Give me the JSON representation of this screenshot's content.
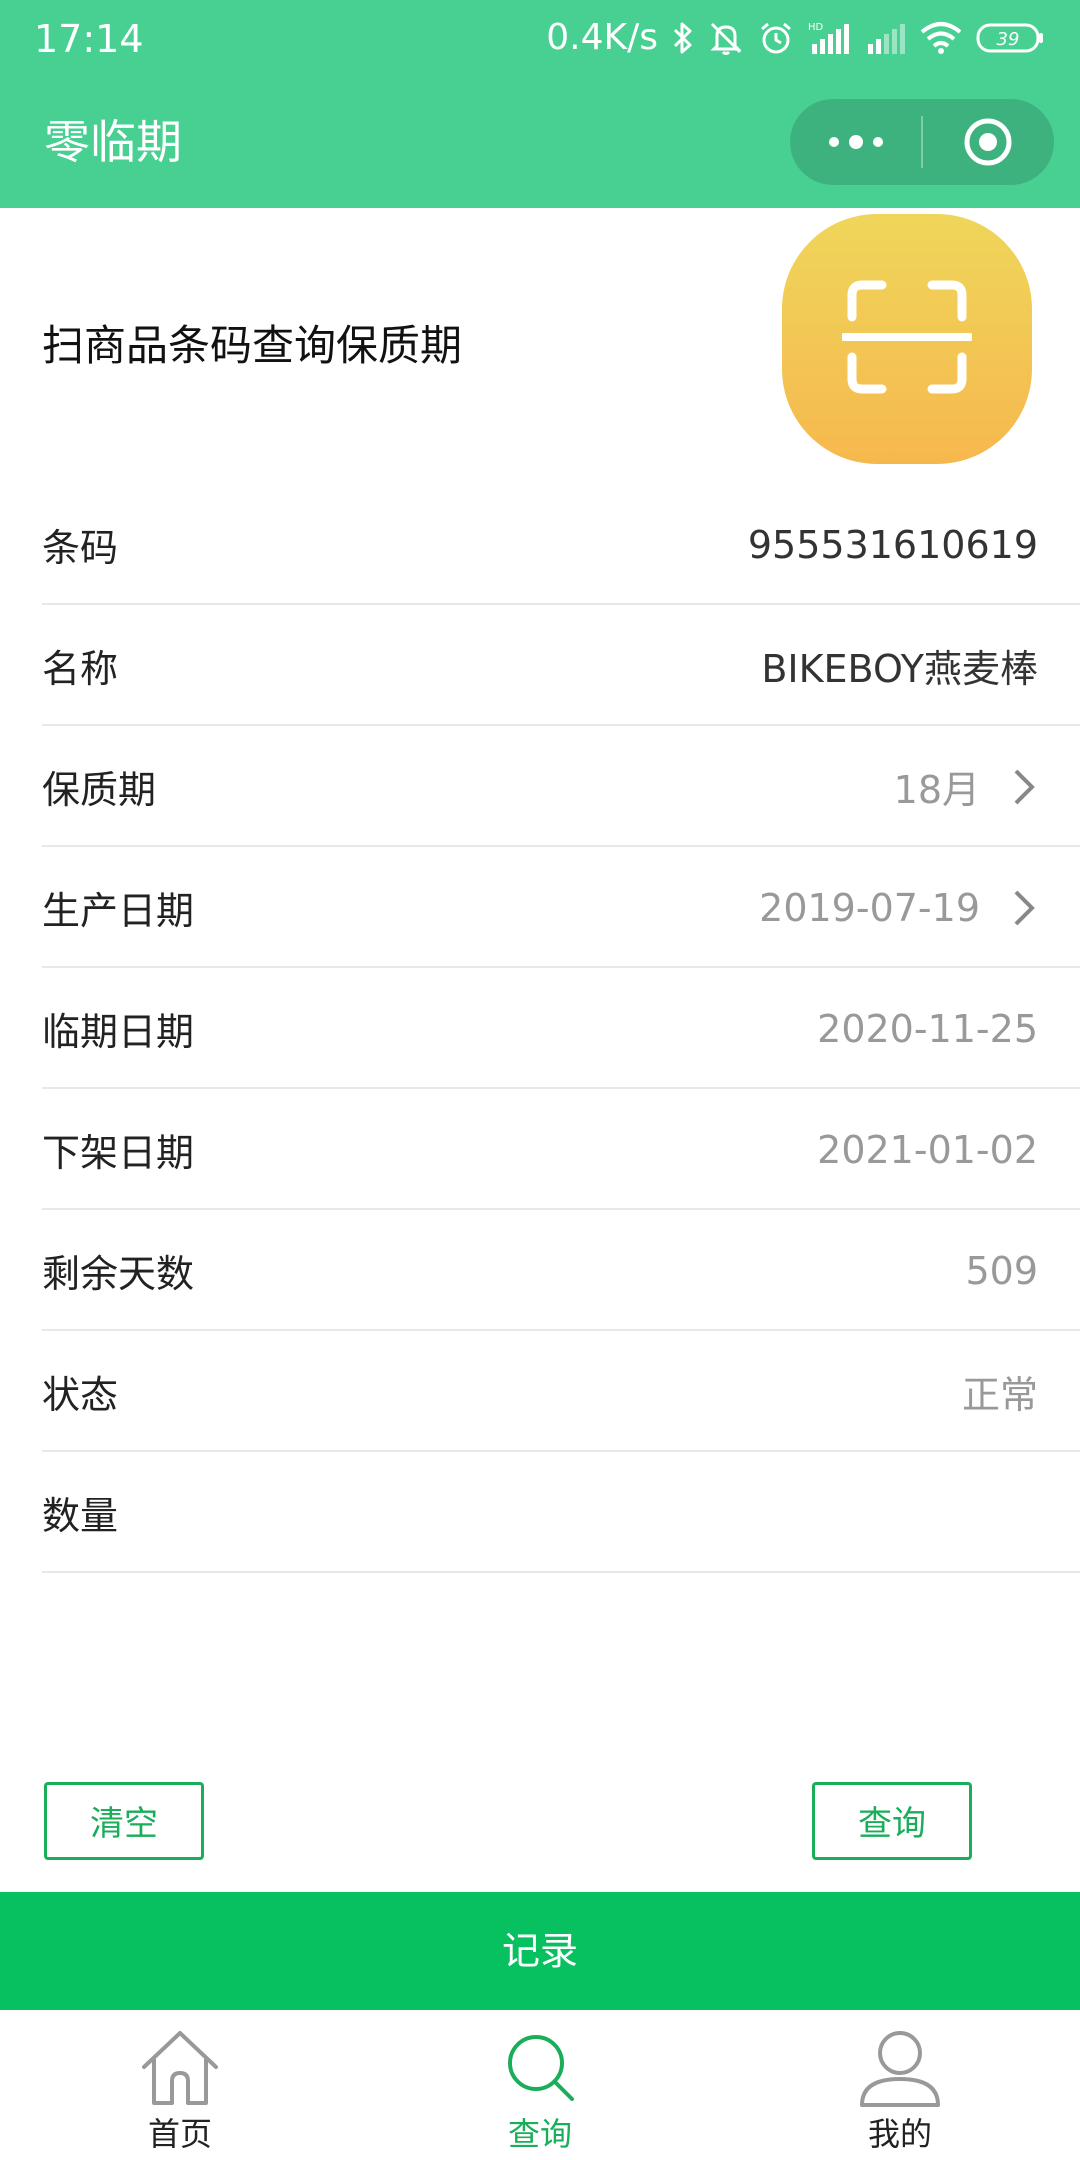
{
  "status_bar": {
    "time": "17:14",
    "network_speed": "0.4K/s",
    "battery": "39",
    "icons": [
      "bluetooth-icon",
      "bell-muted-icon",
      "alarm-icon",
      "hd-signal-icon",
      "signal-icon",
      "wifi-icon",
      "battery-icon"
    ]
  },
  "nav": {
    "title": "零临期",
    "more_icon": "more-dots-icon",
    "close_icon": "target-close-icon"
  },
  "scan": {
    "title": "扫商品条码查询保质期",
    "icon": "scan-icon"
  },
  "rows": [
    {
      "label": "条码",
      "value": "955531610619"
    },
    {
      "label": "名称",
      "value": "BIKEBOY燕麦棒"
    },
    {
      "label": "保质期",
      "value": "18月"
    },
    {
      "label": "生产日期",
      "value": "2019-07-19"
    },
    {
      "label": "临期日期",
      "value": "2020-11-25"
    },
    {
      "label": "下架日期",
      "value": "2021-01-02"
    },
    {
      "label": "剩余天数",
      "value": "509"
    },
    {
      "label": "状态",
      "value": "正常"
    },
    {
      "label": "数量",
      "value": ""
    }
  ],
  "actions": {
    "clear_label": "清空",
    "query_label": "查询",
    "record_label": "记录"
  },
  "tabs": [
    {
      "label": "首页",
      "icon": "home-icon",
      "active": false
    },
    {
      "label": "查询",
      "icon": "search-icon",
      "active": true
    },
    {
      "label": "我的",
      "icon": "user-icon",
      "active": false
    }
  ],
  "colors": {
    "header": "#48d093",
    "accent": "#1aad5a",
    "record_bar": "#07c160",
    "scan_gradient_top": "#efd65a",
    "scan_gradient_bottom": "#f6b84e"
  }
}
